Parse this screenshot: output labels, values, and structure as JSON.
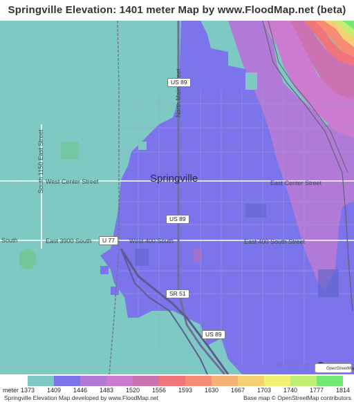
{
  "title": "Springville Elevation: 1401 meter Map by www.FloodMap.net (beta)",
  "map": {
    "labels": {
      "city": "Springville",
      "west_center": "West Center Street",
      "east_center": "East Center Street",
      "south_1150": "South 1150 East Street",
      "north_main": "North Main Street",
      "east_3900": "East 3900 South",
      "south_left": "South",
      "west_400": "West 400 South",
      "east_400": "East 400 South Street"
    },
    "shields": {
      "us89_top": "US 89",
      "us89_mid": "US 89",
      "us89_bottom": "US 89",
      "u77": "U 77",
      "sr51": "SR 51"
    },
    "osm_badge": "OpenStreetMap"
  },
  "legend": {
    "unit": "meter",
    "ticks": [
      "1373",
      "1409",
      "1446",
      "1483",
      "1520",
      "1556",
      "1593",
      "1630",
      "1667",
      "1703",
      "1740",
      "1777",
      "1814"
    ],
    "colors": [
      "#7ec9c4",
      "#7b74ea",
      "#b27ad8",
      "#cd7bd0",
      "#cc72b2",
      "#f0767c",
      "#f58c73",
      "#f5b073",
      "#f5d073",
      "#f0f073",
      "#bff073",
      "#73e873"
    ]
  },
  "footer": {
    "left": "Springville Elevation Map developed by www.FloodMap.net",
    "right": "Base map © OpenStreetMap contributors"
  }
}
